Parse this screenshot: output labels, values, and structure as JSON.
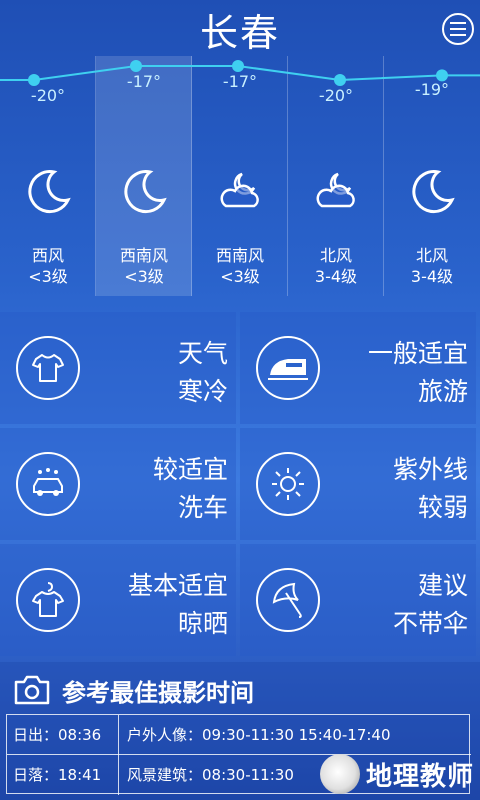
{
  "header": {
    "city": "长春"
  },
  "forecast": [
    {
      "temp": "-20°",
      "temp_value": -20,
      "icon": "moon-icon",
      "wind_dir": "西风",
      "wind_level": "<3级"
    },
    {
      "temp": "-17°",
      "temp_value": -17,
      "icon": "moon-icon",
      "wind_dir": "西南风",
      "wind_level": "<3级"
    },
    {
      "temp": "-17°",
      "temp_value": -17,
      "icon": "cloudy-moon-icon",
      "wind_dir": "西南风",
      "wind_level": "<3级"
    },
    {
      "temp": "-20°",
      "temp_value": -20,
      "icon": "cloudy-moon-icon",
      "wind_dir": "北风",
      "wind_level": "3-4级"
    },
    {
      "temp": "-19°",
      "temp_value": -19,
      "icon": "moon-icon",
      "wind_dir": "北风",
      "wind_level": "3-4级"
    }
  ],
  "indices": [
    {
      "icon": "tshirt-icon",
      "line1": "天气",
      "line2": "寒冷"
    },
    {
      "icon": "train-icon",
      "line1": "一般适宜",
      "line2": "旅游"
    },
    {
      "icon": "car-wash-icon",
      "line1": "较适宜",
      "line2": "洗车"
    },
    {
      "icon": "sun-icon",
      "line1": "紫外线",
      "line2": "较弱"
    },
    {
      "icon": "hanger-shirt-icon",
      "line1": "基本适宜",
      "line2": "晾晒"
    },
    {
      "icon": "umbrella-icon",
      "line1": "建议",
      "line2": "不带伞"
    }
  ],
  "photo": {
    "title": "参考最佳摄影时间",
    "rows": [
      {
        "a": "日出：08:36",
        "b": "户外人像：09:30-11:30   15:40-17:40"
      },
      {
        "a": "日落：18:41",
        "b": "风景建筑：08:30-11:30"
      }
    ]
  },
  "watermark": {
    "text": "地理教师"
  },
  "colors": {
    "accent_line": "#3fd0f0",
    "temp_text": "#c9f0ff"
  }
}
